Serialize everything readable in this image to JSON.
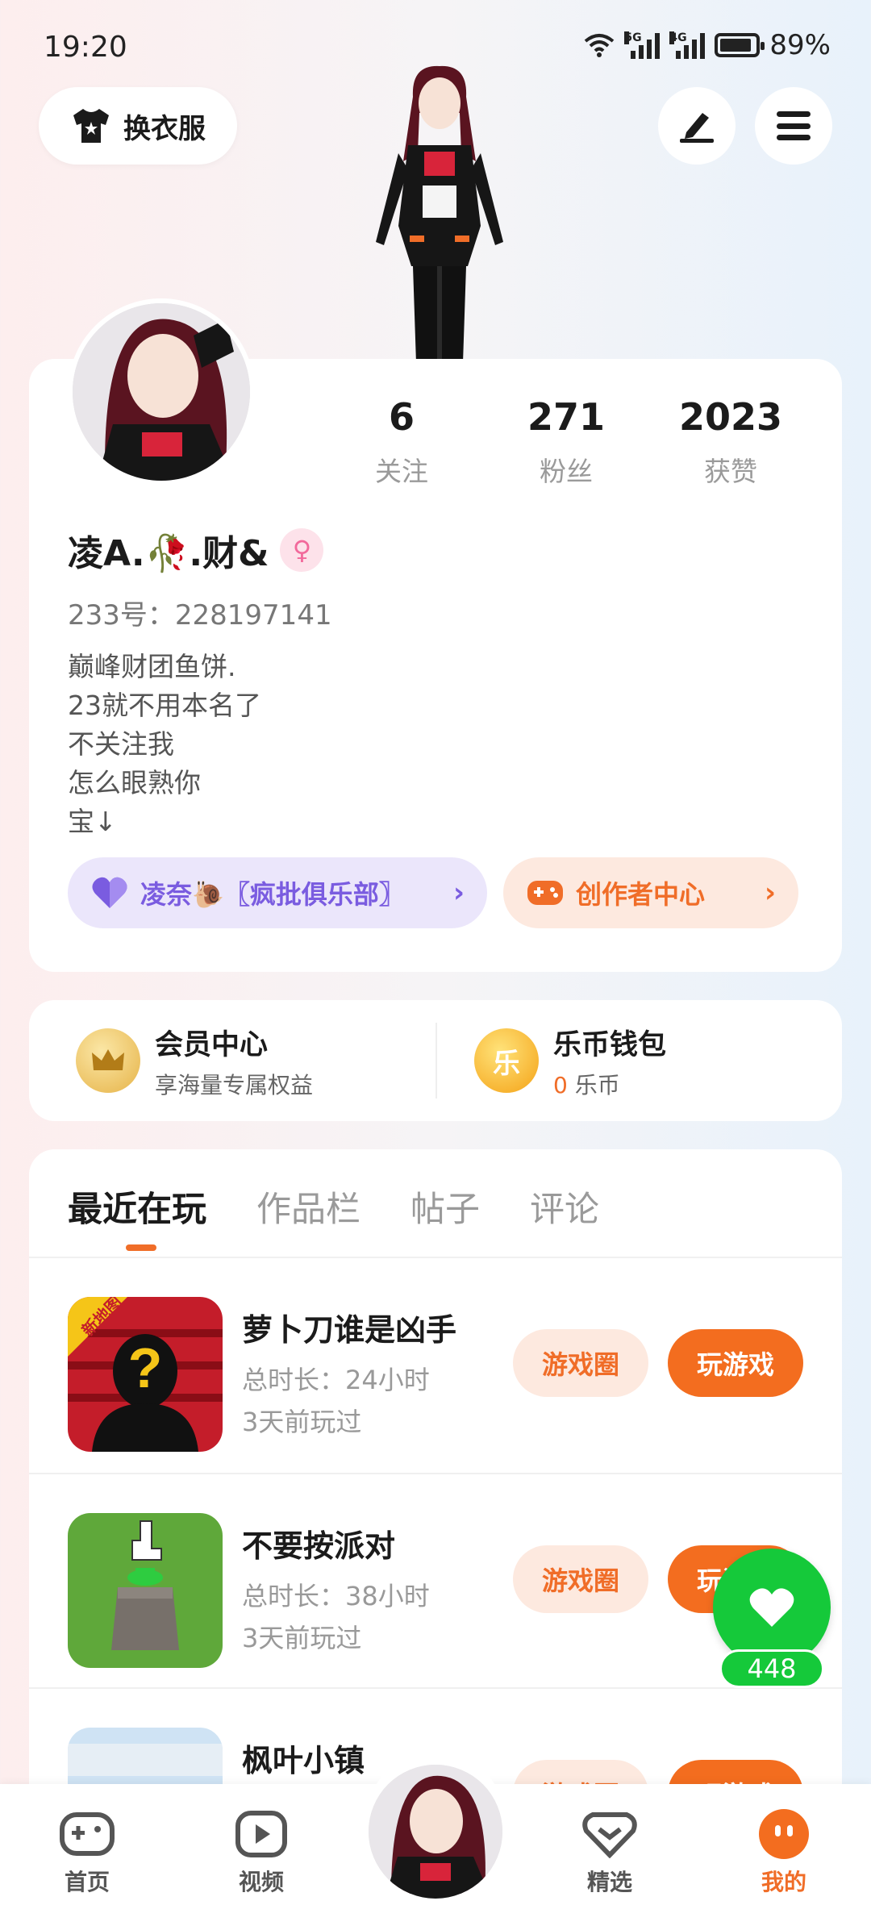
{
  "status": {
    "time": "19:20",
    "net1": "5G",
    "net2": "4G",
    "battery": "89%",
    "battery_level": 0.89
  },
  "header": {
    "outfit_label": "换衣服"
  },
  "profile": {
    "stats": [
      {
        "value": "6",
        "label": "关注"
      },
      {
        "value": "271",
        "label": "粉丝"
      },
      {
        "value": "2023",
        "label": "获赞"
      }
    ],
    "name": "凌A.🥀.财&",
    "gender_symbol": "♀",
    "id_label": "233号：228197141",
    "bio": [
      "巅峰财团鱼饼.",
      "23就不用本名了",
      "不关注我",
      "怎么眼熟你",
      "宝↓"
    ],
    "club_label": "凌奈🐌〖疯批俱乐部〗",
    "creator_label": "创作者中心",
    "chevron": "›"
  },
  "vip": {
    "member_title": "会员中心",
    "member_sub": "享海量专属权益",
    "wallet_title": "乐币钱包",
    "wallet_coin_char": "乐",
    "wallet_amount": "0",
    "wallet_unit": " 乐币"
  },
  "tabs": [
    "最近在玩",
    "作品栏",
    "帖子",
    "评论"
  ],
  "games": [
    {
      "title": "萝卜刀谁是凶手",
      "duration": "总时长：24小时",
      "last": "3天前玩过",
      "badge": "新地图",
      "circle": "游戏圈",
      "play": "玩游戏"
    },
    {
      "title": "不要按派对",
      "duration": "总时长：38小时",
      "last": "3天前玩过",
      "circle": "游戏圈",
      "play": "玩游戏"
    },
    {
      "title": "枫叶小镇",
      "circle": "游戏圈",
      "play": "玩游戏"
    }
  ],
  "like": {
    "count": "448"
  },
  "tabbar": {
    "home": "首页",
    "video": "视频",
    "featured": "精选",
    "mine": "我的"
  }
}
